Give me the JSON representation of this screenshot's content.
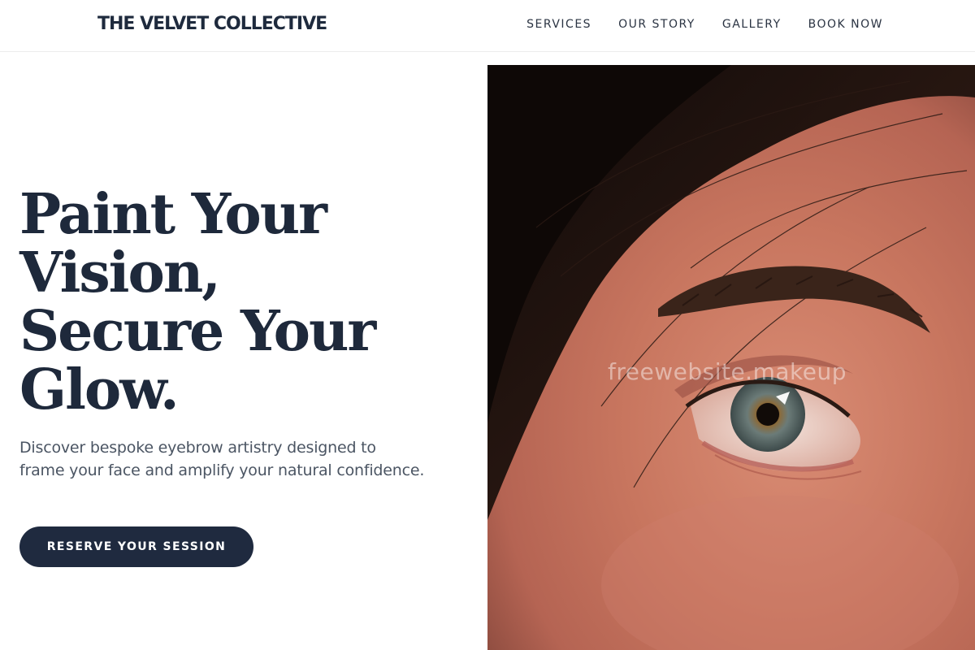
{
  "header": {
    "brand": "THE VELVET COLLECTIVE",
    "nav": [
      {
        "label": "SERVICES"
      },
      {
        "label": "OUR STORY"
      },
      {
        "label": "GALLERY"
      },
      {
        "label": "BOOK NOW"
      }
    ]
  },
  "hero": {
    "title_lines": [
      "Paint Your",
      "Vision,",
      "Secure Your",
      "Glow."
    ],
    "subtitle": "Discover bespoke eyebrow artistry designed to frame your face and amplify your natural confidence.",
    "cta_label": "RESERVE YOUR SESSION",
    "image": {
      "subject": "close-up-eye-eyebrow-photo",
      "watermark": "freewebsite.makeup"
    }
  },
  "colors": {
    "text_dark": "#1e293b",
    "cta_bg": "#1f2a3f",
    "subtitle": "#4b5563"
  }
}
